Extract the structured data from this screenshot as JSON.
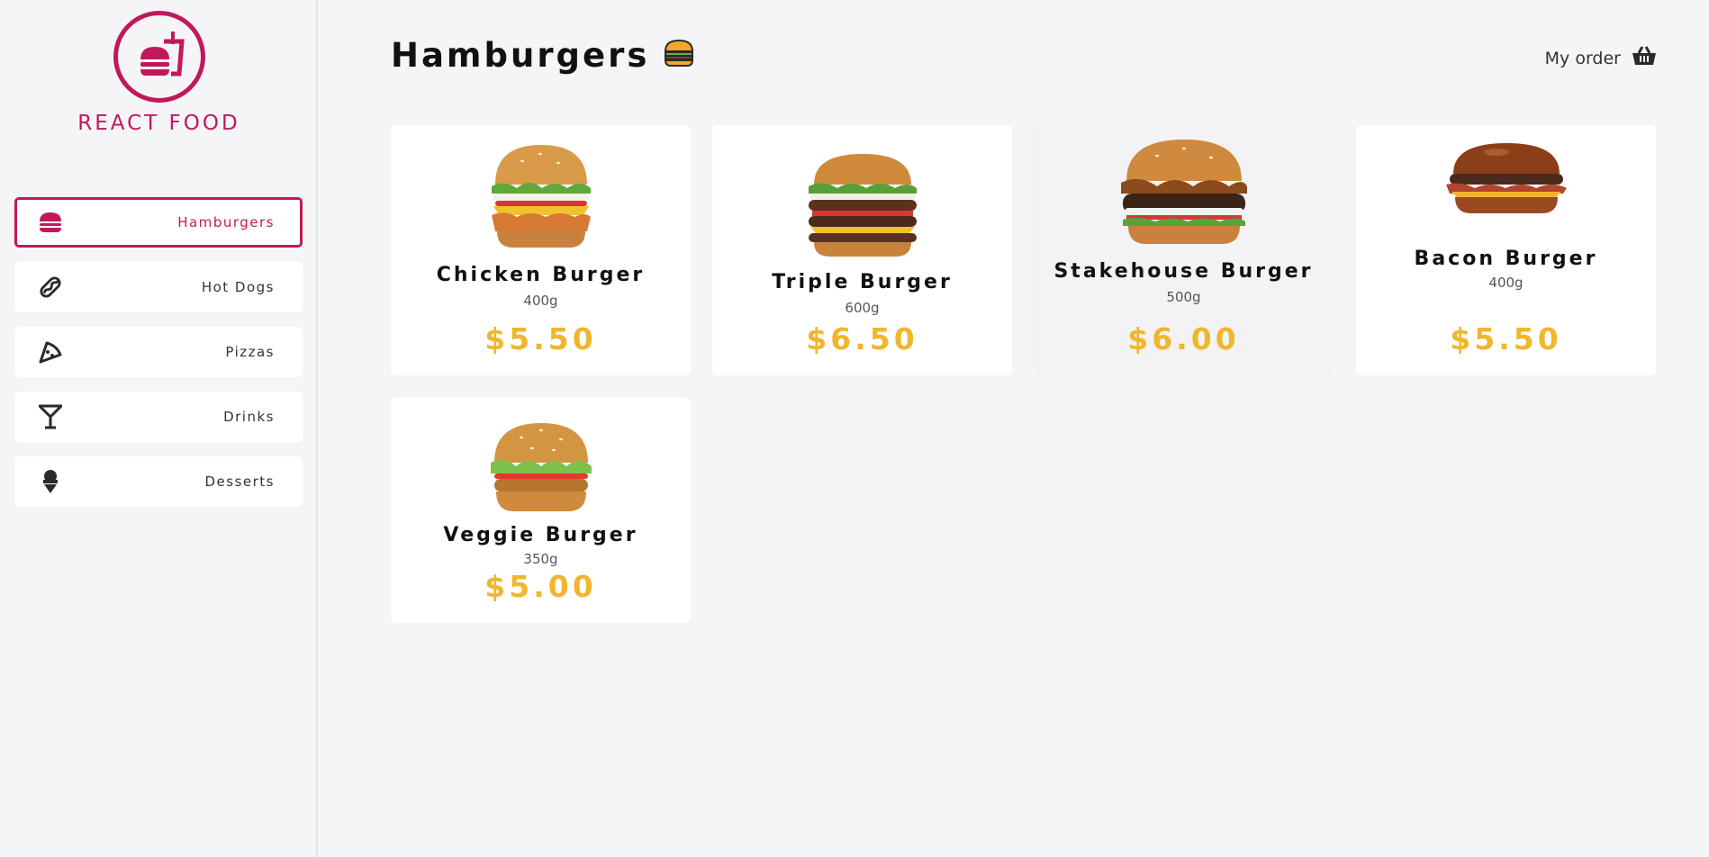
{
  "brand": {
    "title": "REACT FOOD",
    "color": "#c2185b"
  },
  "sidebar": {
    "items": [
      {
        "label": "Hamburgers",
        "icon": "burger-icon",
        "active": true
      },
      {
        "label": "Hot Dogs",
        "icon": "hotdog-icon",
        "active": false
      },
      {
        "label": "Pizzas",
        "icon": "pizza-icon",
        "active": false
      },
      {
        "label": "Drinks",
        "icon": "cocktail-icon",
        "active": false
      },
      {
        "label": "Desserts",
        "icon": "ice-cream-icon",
        "active": false
      }
    ]
  },
  "header": {
    "title": "Hamburgers",
    "title_icon": "burger-emoji-icon",
    "order_label": "My order",
    "order_icon": "basket-icon"
  },
  "products": [
    {
      "name": "Chicken Burger",
      "weight": "400g",
      "price": "$5.50"
    },
    {
      "name": "Triple Burger",
      "weight": "600g",
      "price": "$6.50"
    },
    {
      "name": "Stakehouse Burger",
      "weight": "500g",
      "price": "$6.00"
    },
    {
      "name": "Bacon Burger",
      "weight": "400g",
      "price": "$5.50"
    },
    {
      "name": "Veggie Burger",
      "weight": "350g",
      "price": "$5.00"
    }
  ],
  "colors": {
    "accent": "#c2185b",
    "price": "#f0b62c",
    "background": "#f5f5f7"
  }
}
